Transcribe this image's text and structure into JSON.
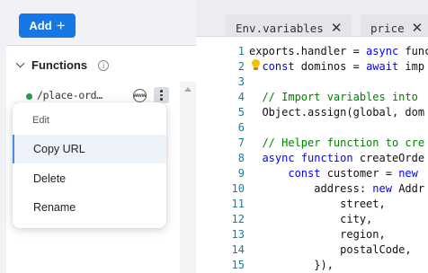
{
  "add_button": {
    "label": "Add",
    "plus": "+"
  },
  "sidebar": {
    "section_title": "Functions",
    "info_icon": "i",
    "functions": [
      {
        "name": "/place-ord…",
        "status_color": "#1e9e4a",
        "badge": "www"
      }
    ]
  },
  "context_menu": {
    "heading": "Edit",
    "items": [
      {
        "label": "Copy URL"
      },
      {
        "label": "Delete"
      },
      {
        "label": "Rename"
      }
    ]
  },
  "tabs": [
    {
      "label": "Env.variables",
      "close": "✕"
    },
    {
      "label": "price",
      "close": "✕"
    }
  ],
  "editor": {
    "line_numbers": [
      "1",
      "2",
      "3",
      "4",
      "5",
      "6",
      "7",
      "8",
      "9",
      "10",
      "11",
      "12",
      "13",
      "14",
      "15"
    ],
    "lines": [
      {
        "text": "exports.handler = async funct"
      },
      {
        "text": "  const dominos = await imp"
      },
      {
        "text": ""
      },
      {
        "text": "  // Import variables into"
      },
      {
        "text": "  Object.assign(global, dom"
      },
      {
        "text": ""
      },
      {
        "text": "  // Helper function to cre"
      },
      {
        "text": "  async function createOrde"
      },
      {
        "text": "      const customer = new"
      },
      {
        "text": "          address: new Addr"
      },
      {
        "text": "              street,"
      },
      {
        "text": "              city,"
      },
      {
        "text": "              region,"
      },
      {
        "text": "              postalCode,"
      },
      {
        "text": "          }),"
      }
    ]
  },
  "colors": {
    "accent": "#1677e6",
    "status_active": "#1e9e4a",
    "keyword": "#0000ff",
    "comment": "#008000",
    "line_number": "#237893"
  }
}
